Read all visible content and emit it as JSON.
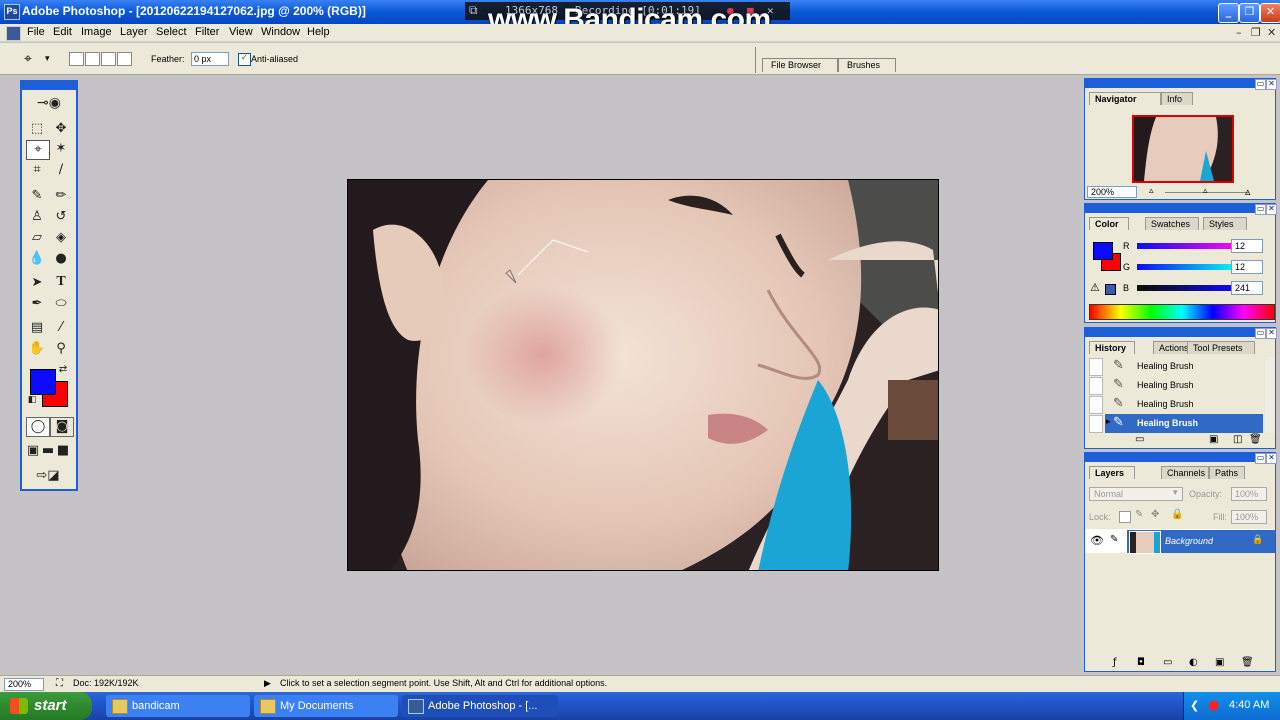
{
  "window": {
    "title": "Adobe Photoshop - [20120622194127062.jpg @ 200% (RGB)]"
  },
  "bandicam": {
    "resolution": "1366x768",
    "recording": "Recording [0:01:19]",
    "watermark": "www.Bandicam.com"
  },
  "menu": [
    "File",
    "Edit",
    "Image",
    "Layer",
    "Select",
    "Filter",
    "View",
    "Window",
    "Help"
  ],
  "options": {
    "feather_label": "Feather:",
    "feather_value": "0 px",
    "antialias_label": "Anti-aliased",
    "antialias_checked": true
  },
  "palette_well": {
    "tabs": [
      "File Browser",
      "Brushes"
    ]
  },
  "colors": {
    "foreground": "#0a0aff",
    "background": "#ff0000",
    "titlebar": "#0a58d8",
    "selection": "#316ac5"
  },
  "navigator": {
    "tabs": [
      "Navigator",
      "Info"
    ],
    "zoom": "200%"
  },
  "color_panel": {
    "tabs": [
      "Color",
      "Swatches",
      "Styles"
    ],
    "channels": [
      {
        "label": "R",
        "value": "12"
      },
      {
        "label": "G",
        "value": "12"
      },
      {
        "label": "B",
        "value": "241"
      }
    ]
  },
  "history": {
    "tabs": [
      "History",
      "Actions",
      "Tool Presets"
    ],
    "items": [
      "Healing Brush",
      "Healing Brush",
      "Healing Brush",
      "Healing Brush"
    ]
  },
  "layers": {
    "tabs": [
      "Layers",
      "Channels",
      "Paths"
    ],
    "blend_mode": "Normal",
    "opacity_label": "Opacity:",
    "opacity": "100%",
    "lock_label": "Lock:",
    "fill_label": "Fill:",
    "fill": "100%",
    "layer_name": "Background"
  },
  "status": {
    "zoom": "200%",
    "doc": "Doc: 192K/192K",
    "hint": "Click to set a selection segment point. Use Shift, Alt and Ctrl for additional options."
  },
  "taskbar": {
    "start": "start",
    "tasks": [
      "bandicam",
      "My Documents",
      "Adobe Photoshop - [..."
    ],
    "clock": "4:40 AM"
  }
}
